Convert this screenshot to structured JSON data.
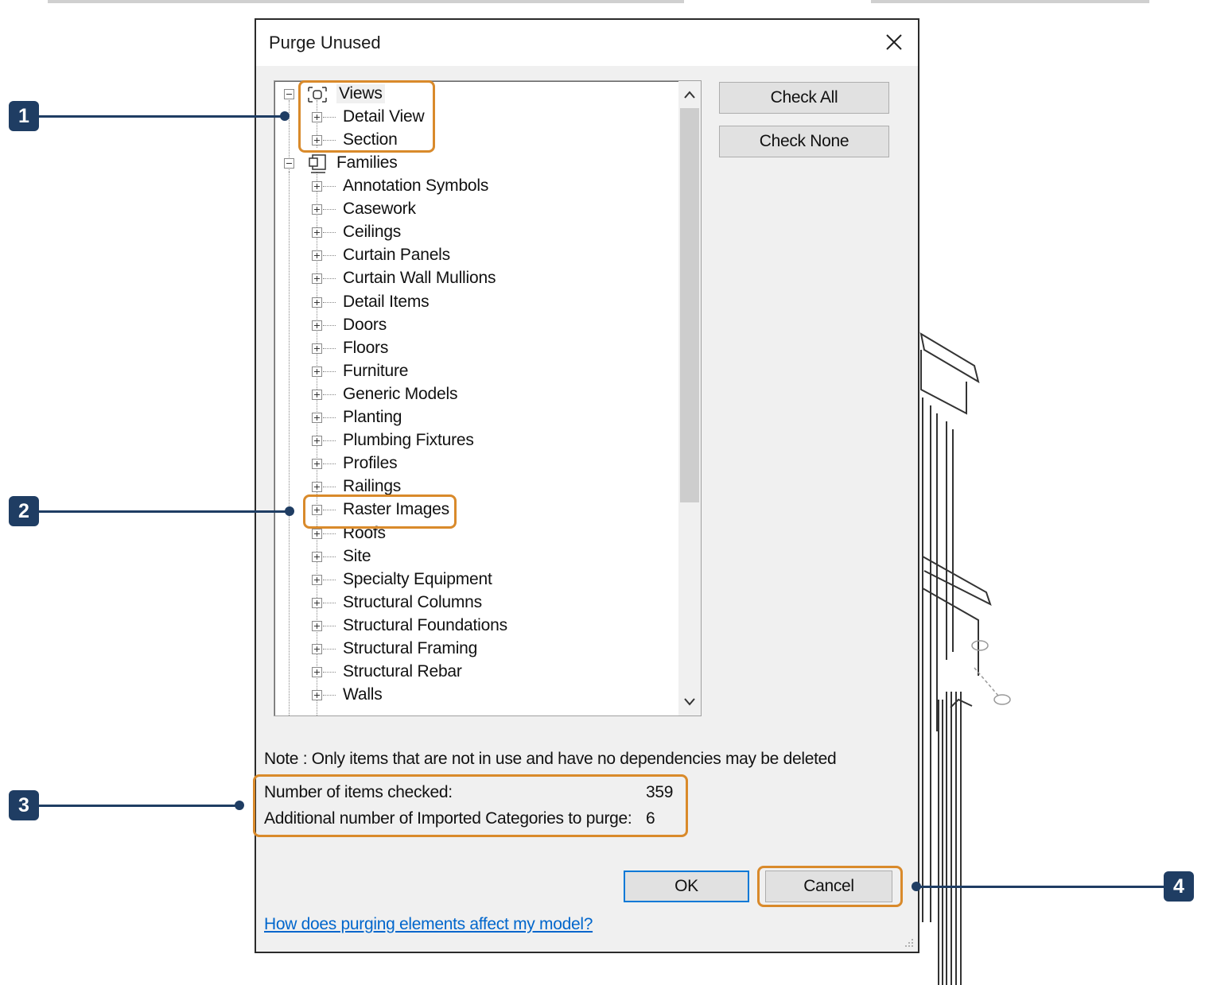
{
  "dialog": {
    "title": "Purge Unused",
    "close_icon": "close-icon"
  },
  "tree": {
    "views": {
      "label": "Views",
      "children": [
        "Detail View",
        "Section"
      ]
    },
    "families": {
      "label": "Families",
      "children": [
        "Annotation Symbols",
        "Casework",
        "Ceilings",
        "Curtain Panels",
        "Curtain Wall Mullions",
        "Detail Items",
        "Doors",
        "Floors",
        "Furniture",
        "Generic Models",
        "Planting",
        "Plumbing Fixtures",
        "Profiles",
        "Railings",
        "Raster Images",
        "Roofs",
        "Site",
        "Specialty Equipment",
        "Structural Columns",
        "Structural Foundations",
        "Structural Framing",
        "Structural Rebar",
        "Walls"
      ]
    }
  },
  "buttons": {
    "check_all": "Check All",
    "check_none": "Check None",
    "ok": "OK",
    "cancel": "Cancel"
  },
  "note": "Note : Only items that are not in use and have no dependencies may be deleted",
  "stats": {
    "checked_label": "Number of items checked:",
    "checked_value": "359",
    "imported_label": "Additional number of Imported Categories to purge:",
    "imported_value": "6"
  },
  "help_link": "How does purging elements affect my model?",
  "callouts": [
    "1",
    "2",
    "3",
    "4"
  ],
  "colors": {
    "highlight": "#d98a2b",
    "callout": "#1f3d63",
    "link": "#0066cc",
    "primary_border": "#0078d7"
  }
}
